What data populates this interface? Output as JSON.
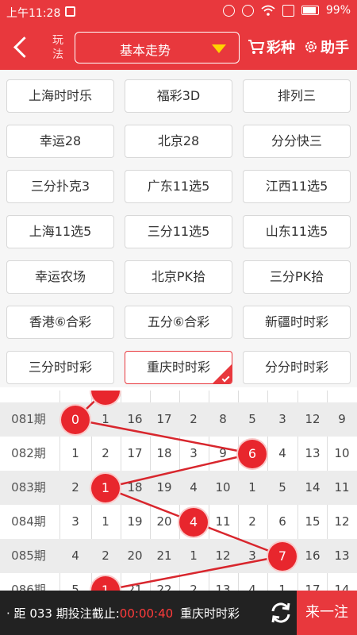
{
  "status_bar": {
    "time": "上午11:28",
    "battery": "99%"
  },
  "header": {
    "wanfa_label": "玩法",
    "play_type": "基本走势",
    "lottery_label": "彩种",
    "helper_label": "助手"
  },
  "lottery_grid": {
    "items": [
      "上海时时乐",
      "福彩3D",
      "排列三",
      "幸运28",
      "北京28",
      "分分快三",
      "三分扑克3",
      "广东11选5",
      "江西11选5",
      "上海11选5",
      "三分11选5",
      "山东11选5",
      "幸运农场",
      "北京PK拾",
      "三分PK拾",
      "香港⑥合彩",
      "五分⑥合彩",
      "新疆时时彩",
      "三分时时彩",
      "重庆时时彩",
      "分分时时彩"
    ],
    "selected": "重庆时时彩"
  },
  "trend_table": {
    "rows": [
      {
        "period": "081期",
        "values": [
          "0",
          "1",
          "16",
          "17",
          "2",
          "8",
          "5",
          "3",
          "12",
          "9"
        ],
        "hit": 0
      },
      {
        "period": "082期",
        "values": [
          "1",
          "2",
          "17",
          "18",
          "3",
          "9",
          "6",
          "4",
          "13",
          "10"
        ],
        "hit": 6
      },
      {
        "period": "083期",
        "values": [
          "2",
          "1",
          "18",
          "19",
          "4",
          "10",
          "1",
          "5",
          "14",
          "11"
        ],
        "hit": 1
      },
      {
        "period": "084期",
        "values": [
          "3",
          "1",
          "19",
          "20",
          "4",
          "11",
          "2",
          "6",
          "15",
          "12"
        ],
        "hit": 4
      },
      {
        "period": "085期",
        "values": [
          "4",
          "2",
          "20",
          "21",
          "1",
          "12",
          "3",
          "7",
          "16",
          "13"
        ],
        "hit": 7
      },
      {
        "period": "086期",
        "values": [
          "5",
          "1",
          "21",
          "22",
          "2",
          "13",
          "4",
          "1",
          "17",
          "14"
        ],
        "hit": 1
      }
    ]
  },
  "bottom_bar": {
    "distance_label": "距 033",
    "deadline_label": "期投注截止:",
    "countdown": "00:00:40",
    "lottery_name": "重庆时时彩",
    "submit_label": "来一注"
  },
  "colors": {
    "brand_red": "#e8383d",
    "ball_red": "#e8262d",
    "bar_dark": "#222222"
  }
}
